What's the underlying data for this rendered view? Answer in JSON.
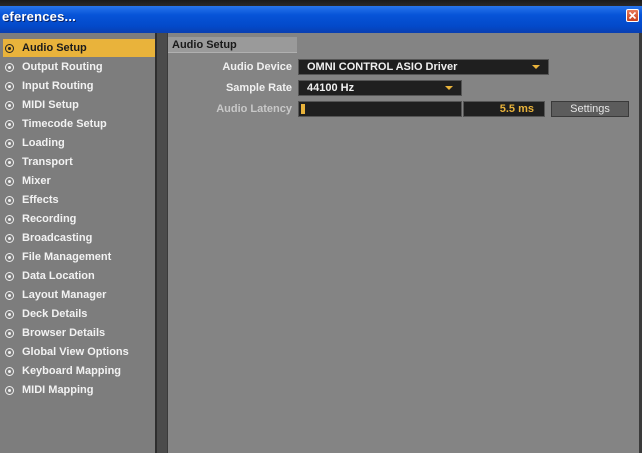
{
  "window": {
    "title": "eferences..."
  },
  "sidebar": {
    "items": [
      {
        "label": "Audio Setup",
        "selected": true
      },
      {
        "label": "Output Routing"
      },
      {
        "label": "Input Routing"
      },
      {
        "label": "MIDI Setup"
      },
      {
        "label": "Timecode Setup"
      },
      {
        "label": "Loading"
      },
      {
        "label": "Transport"
      },
      {
        "label": "Mixer"
      },
      {
        "label": "Effects"
      },
      {
        "label": "Recording"
      },
      {
        "label": "Broadcasting"
      },
      {
        "label": "File Management"
      },
      {
        "label": "Data Location"
      },
      {
        "label": "Layout Manager"
      },
      {
        "label": "Deck Details"
      },
      {
        "label": "Browser Details"
      },
      {
        "label": "Global View Options"
      },
      {
        "label": "Keyboard Mapping"
      },
      {
        "label": "MIDI Mapping"
      }
    ]
  },
  "main": {
    "section_title": "Audio Setup",
    "audio_device": {
      "label": "Audio Device",
      "value": "OMNI CONTROL ASIO Driver"
    },
    "sample_rate": {
      "label": "Sample Rate",
      "value": "44100 Hz"
    },
    "audio_latency": {
      "label": "Audio Latency",
      "value": "5.5 ms",
      "level_fraction": 0.02,
      "settings_label": "Settings"
    }
  },
  "colors": {
    "accent": "#e9b33b",
    "titlebar": "#0754d8",
    "panel": "#848484",
    "field_bg": "#1f1f1f"
  },
  "icons": {
    "close": "close-icon",
    "bullet": "radio-bullet-icon",
    "dropdown": "chevron-down-icon"
  }
}
